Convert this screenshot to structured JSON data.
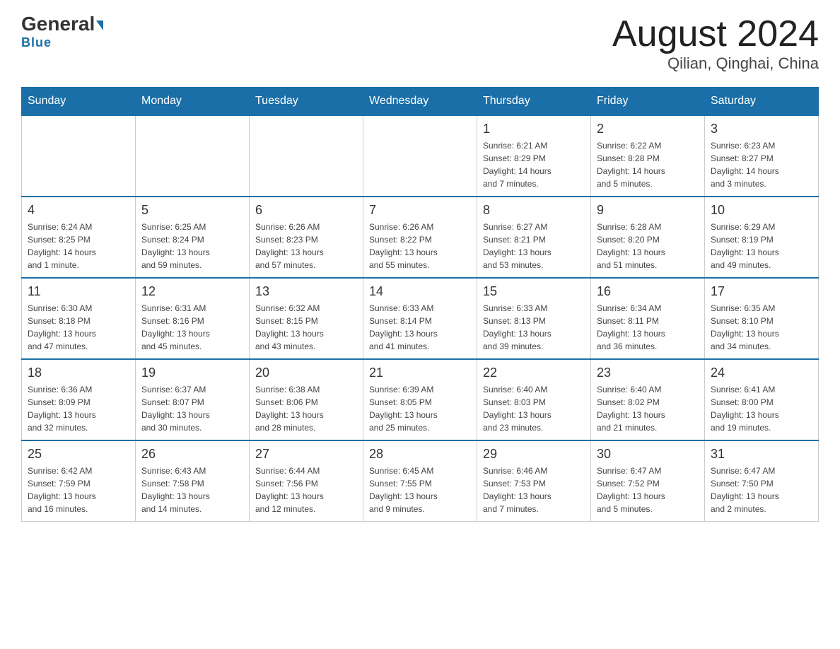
{
  "header": {
    "logo_general": "General",
    "logo_blue": "Blue",
    "month_title": "August 2024",
    "location": "Qilian, Qinghai, China"
  },
  "days_of_week": [
    "Sunday",
    "Monday",
    "Tuesday",
    "Wednesday",
    "Thursday",
    "Friday",
    "Saturday"
  ],
  "weeks": [
    [
      {
        "day": "",
        "info": ""
      },
      {
        "day": "",
        "info": ""
      },
      {
        "day": "",
        "info": ""
      },
      {
        "day": "",
        "info": ""
      },
      {
        "day": "1",
        "info": "Sunrise: 6:21 AM\nSunset: 8:29 PM\nDaylight: 14 hours\nand 7 minutes."
      },
      {
        "day": "2",
        "info": "Sunrise: 6:22 AM\nSunset: 8:28 PM\nDaylight: 14 hours\nand 5 minutes."
      },
      {
        "day": "3",
        "info": "Sunrise: 6:23 AM\nSunset: 8:27 PM\nDaylight: 14 hours\nand 3 minutes."
      }
    ],
    [
      {
        "day": "4",
        "info": "Sunrise: 6:24 AM\nSunset: 8:25 PM\nDaylight: 14 hours\nand 1 minute."
      },
      {
        "day": "5",
        "info": "Sunrise: 6:25 AM\nSunset: 8:24 PM\nDaylight: 13 hours\nand 59 minutes."
      },
      {
        "day": "6",
        "info": "Sunrise: 6:26 AM\nSunset: 8:23 PM\nDaylight: 13 hours\nand 57 minutes."
      },
      {
        "day": "7",
        "info": "Sunrise: 6:26 AM\nSunset: 8:22 PM\nDaylight: 13 hours\nand 55 minutes."
      },
      {
        "day": "8",
        "info": "Sunrise: 6:27 AM\nSunset: 8:21 PM\nDaylight: 13 hours\nand 53 minutes."
      },
      {
        "day": "9",
        "info": "Sunrise: 6:28 AM\nSunset: 8:20 PM\nDaylight: 13 hours\nand 51 minutes."
      },
      {
        "day": "10",
        "info": "Sunrise: 6:29 AM\nSunset: 8:19 PM\nDaylight: 13 hours\nand 49 minutes."
      }
    ],
    [
      {
        "day": "11",
        "info": "Sunrise: 6:30 AM\nSunset: 8:18 PM\nDaylight: 13 hours\nand 47 minutes."
      },
      {
        "day": "12",
        "info": "Sunrise: 6:31 AM\nSunset: 8:16 PM\nDaylight: 13 hours\nand 45 minutes."
      },
      {
        "day": "13",
        "info": "Sunrise: 6:32 AM\nSunset: 8:15 PM\nDaylight: 13 hours\nand 43 minutes."
      },
      {
        "day": "14",
        "info": "Sunrise: 6:33 AM\nSunset: 8:14 PM\nDaylight: 13 hours\nand 41 minutes."
      },
      {
        "day": "15",
        "info": "Sunrise: 6:33 AM\nSunset: 8:13 PM\nDaylight: 13 hours\nand 39 minutes."
      },
      {
        "day": "16",
        "info": "Sunrise: 6:34 AM\nSunset: 8:11 PM\nDaylight: 13 hours\nand 36 minutes."
      },
      {
        "day": "17",
        "info": "Sunrise: 6:35 AM\nSunset: 8:10 PM\nDaylight: 13 hours\nand 34 minutes."
      }
    ],
    [
      {
        "day": "18",
        "info": "Sunrise: 6:36 AM\nSunset: 8:09 PM\nDaylight: 13 hours\nand 32 minutes."
      },
      {
        "day": "19",
        "info": "Sunrise: 6:37 AM\nSunset: 8:07 PM\nDaylight: 13 hours\nand 30 minutes."
      },
      {
        "day": "20",
        "info": "Sunrise: 6:38 AM\nSunset: 8:06 PM\nDaylight: 13 hours\nand 28 minutes."
      },
      {
        "day": "21",
        "info": "Sunrise: 6:39 AM\nSunset: 8:05 PM\nDaylight: 13 hours\nand 25 minutes."
      },
      {
        "day": "22",
        "info": "Sunrise: 6:40 AM\nSunset: 8:03 PM\nDaylight: 13 hours\nand 23 minutes."
      },
      {
        "day": "23",
        "info": "Sunrise: 6:40 AM\nSunset: 8:02 PM\nDaylight: 13 hours\nand 21 minutes."
      },
      {
        "day": "24",
        "info": "Sunrise: 6:41 AM\nSunset: 8:00 PM\nDaylight: 13 hours\nand 19 minutes."
      }
    ],
    [
      {
        "day": "25",
        "info": "Sunrise: 6:42 AM\nSunset: 7:59 PM\nDaylight: 13 hours\nand 16 minutes."
      },
      {
        "day": "26",
        "info": "Sunrise: 6:43 AM\nSunset: 7:58 PM\nDaylight: 13 hours\nand 14 minutes."
      },
      {
        "day": "27",
        "info": "Sunrise: 6:44 AM\nSunset: 7:56 PM\nDaylight: 13 hours\nand 12 minutes."
      },
      {
        "day": "28",
        "info": "Sunrise: 6:45 AM\nSunset: 7:55 PM\nDaylight: 13 hours\nand 9 minutes."
      },
      {
        "day": "29",
        "info": "Sunrise: 6:46 AM\nSunset: 7:53 PM\nDaylight: 13 hours\nand 7 minutes."
      },
      {
        "day": "30",
        "info": "Sunrise: 6:47 AM\nSunset: 7:52 PM\nDaylight: 13 hours\nand 5 minutes."
      },
      {
        "day": "31",
        "info": "Sunrise: 6:47 AM\nSunset: 7:50 PM\nDaylight: 13 hours\nand 2 minutes."
      }
    ]
  ]
}
